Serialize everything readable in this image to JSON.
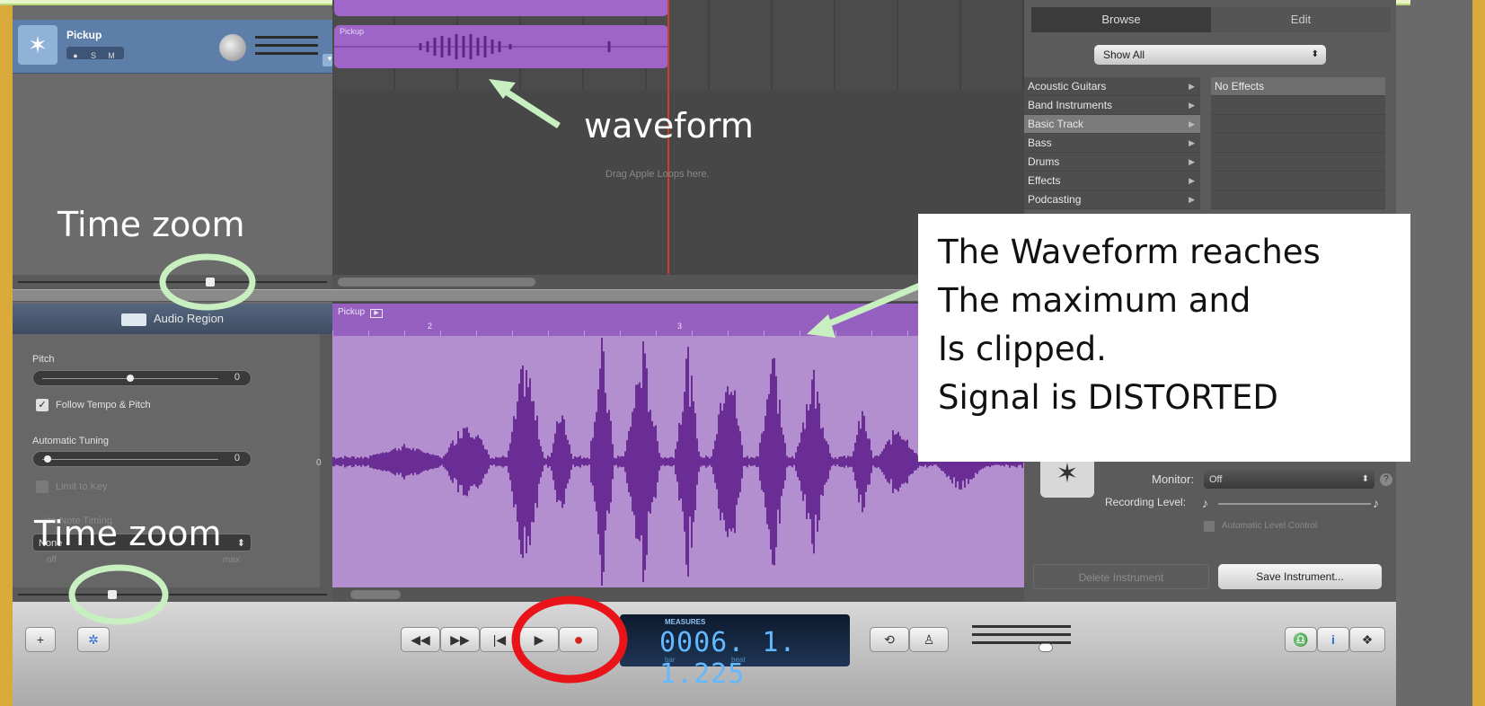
{
  "track": {
    "name": "Pickup",
    "buttons": [
      "●",
      "S",
      "M"
    ]
  },
  "timeline": {
    "region_name": "Pickup",
    "drag_hint": "Drag Apple Loops here."
  },
  "library": {
    "tabs": [
      "Browse",
      "Edit"
    ],
    "show_filter": "Show All",
    "categories": [
      "Acoustic Guitars",
      "Band Instruments",
      "Basic Track",
      "Bass",
      "Drums",
      "Effects",
      "Podcasting"
    ],
    "selected_category": "Basic Track",
    "effects": [
      "No Effects"
    ],
    "monitor_label": "Monitor:",
    "monitor_value": "Off",
    "recording_level_label": "Recording Level:",
    "automatic_level_control": "Automatic Level Control",
    "delete_instrument": "Delete Instrument",
    "save_instrument": "Save Instrument..."
  },
  "editor": {
    "header": "Audio Region",
    "region_name": "Pickup",
    "ruler_ticks": [
      "2",
      "3"
    ],
    "zero_label": "0",
    "pitch_label": "Pitch",
    "pitch_value": "0",
    "follow_tempo_label": "Follow Tempo & Pitch",
    "follow_tempo_checked": true,
    "auto_tuning_label": "Automatic Tuning",
    "auto_tuning_value": "0",
    "limit_to_key_label": "Limit to Key",
    "quantize_label": "...ize Note Timing",
    "quantize_value": "None",
    "range_min": "off",
    "range_max": "max"
  },
  "transport": {
    "lcd_caption": "MEASURES",
    "lcd_value": "0006. 1. 1.225",
    "lcd_bar": "bar",
    "lcd_beat": "beat",
    "buttons": {
      "rewind": "◀◀",
      "forward": "▶▶",
      "to_start": "|◀",
      "play": "▶",
      "record": "●",
      "cycle": "⟲",
      "metronome": "♙",
      "add_track": "+",
      "smart_controls": "✲",
      "tuner": "♎",
      "info": "i",
      "loop_browser": "❖"
    }
  },
  "annotations": {
    "waveform": "waveform",
    "time_zoom_top": "Time zoom",
    "time_zoom_bottom": "Time zoom",
    "clipping_note": [
      "The Waveform reaches",
      "The maximum and",
      "Is clipped.",
      "Signal is DISTORTED"
    ],
    "colors": {
      "highlight_green": "#c8efc0",
      "record_circle_red": "#e8141a"
    }
  }
}
